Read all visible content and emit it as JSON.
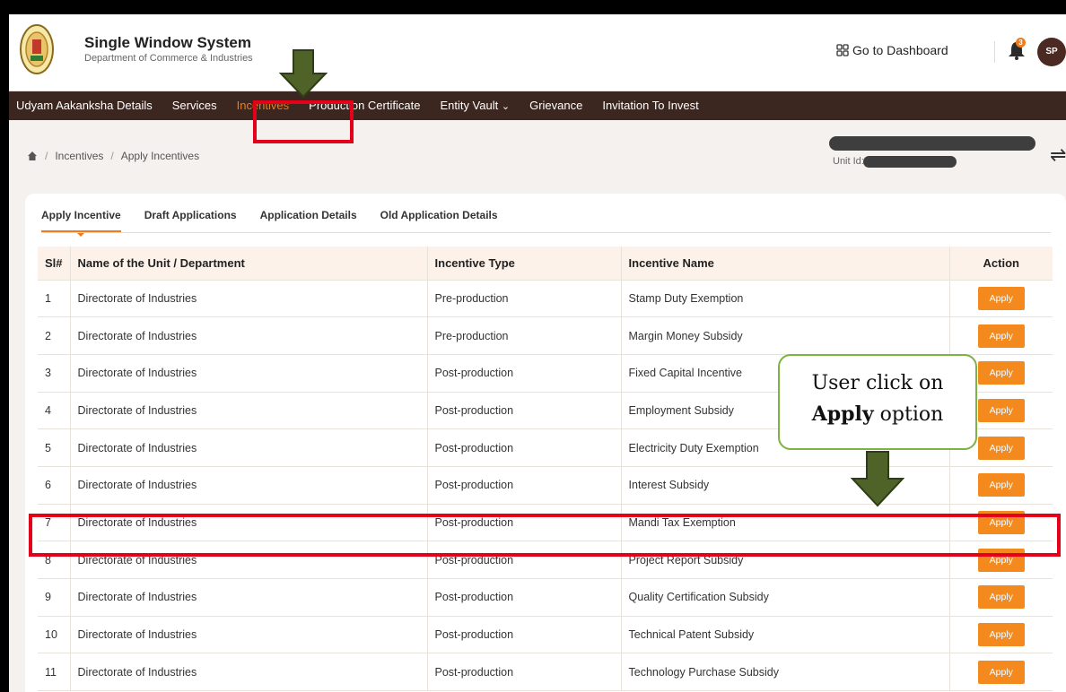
{
  "header": {
    "title": "Single Window System",
    "subtitle": "Department of Commerce & Industries",
    "dashboard_label": "Go to Dashboard",
    "notification_count": "3",
    "avatar_initials": "SP"
  },
  "nav": {
    "items": [
      {
        "label": "Udyam Aakanksha Details"
      },
      {
        "label": "Services"
      },
      {
        "label": "Incentives"
      },
      {
        "label": "Production Certificate"
      },
      {
        "label": "Entity Vault"
      },
      {
        "label": "Grievance"
      },
      {
        "label": "Invitation To Invest"
      }
    ]
  },
  "breadcrumb": {
    "items": [
      "Incentives",
      "Apply Incentives"
    ]
  },
  "unit": {
    "label": "Unit Id:"
  },
  "tabs": [
    "Apply Incentive",
    "Draft Applications",
    "Application Details",
    "Old Application Details"
  ],
  "table": {
    "headers": [
      "Sl#",
      "Name of the Unit / Department",
      "Incentive Type",
      "Incentive Name",
      "Action"
    ],
    "rows": [
      [
        "1",
        "Directorate of Industries",
        "Pre-production",
        "Stamp Duty Exemption",
        "Apply"
      ],
      [
        "2",
        "Directorate of Industries",
        "Pre-production",
        "Margin Money Subsidy",
        "Apply"
      ],
      [
        "3",
        "Directorate of Industries",
        "Post-production",
        "Fixed Capital Incentive",
        "Apply"
      ],
      [
        "4",
        "Directorate of Industries",
        "Post-production",
        "Employment Subsidy",
        "Apply"
      ],
      [
        "5",
        "Directorate of Industries",
        "Post-production",
        "Electricity Duty Exemption",
        "Apply"
      ],
      [
        "6",
        "Directorate of Industries",
        "Post-production",
        "Interest Subsidy",
        "Apply"
      ],
      [
        "7",
        "Directorate of Industries",
        "Post-production",
        "Mandi Tax Exemption",
        "Apply"
      ],
      [
        "8",
        "Directorate of Industries",
        "Post-production",
        "Project Report Subsidy",
        "Apply"
      ],
      [
        "9",
        "Directorate of Industries",
        "Post-production",
        "Quality Certification Subsidy",
        "Apply"
      ],
      [
        "10",
        "Directorate of Industries",
        "Post-production",
        "Technical Patent Subsidy",
        "Apply"
      ],
      [
        "11",
        "Directorate of Industries",
        "Post-production",
        "Technology Purchase Subsidy",
        "Apply"
      ]
    ]
  },
  "annotation": {
    "line1": "User click on",
    "bold": "Apply",
    "rest": " option"
  },
  "colors": {
    "accent": "#f07c1c",
    "nav_bg": "#3b2620",
    "highlight_box": "#e5001a",
    "arrow": "#4f6228"
  }
}
